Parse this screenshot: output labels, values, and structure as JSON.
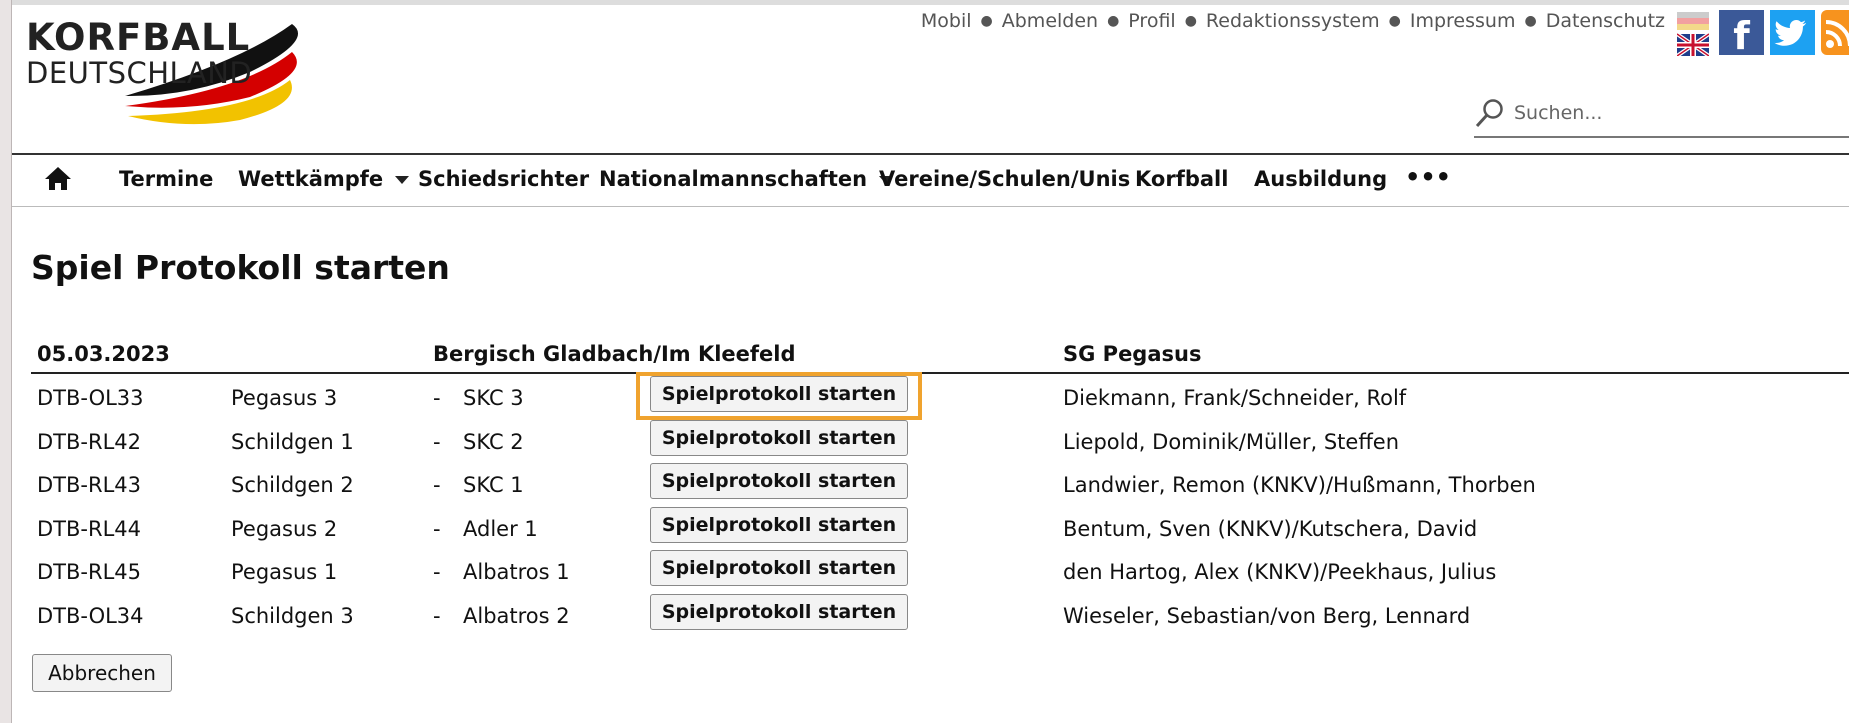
{
  "logo": {
    "line1": "KORFBALL",
    "line2": "DEUTSCHLAND"
  },
  "toplinks": [
    "Mobil",
    "Abmelden",
    "Profil",
    "Redaktionssystem",
    "Impressum",
    "Datenschutz"
  ],
  "search": {
    "placeholder": "Suchen..."
  },
  "nav": {
    "items": [
      "Termine",
      "Wettkämpfe",
      "Schiedsrichter",
      "Nationalmannschaften",
      "Vereine/Schulen/Unis",
      "Korfball",
      "Ausbildung"
    ],
    "more": "•••"
  },
  "page": {
    "title": "Spiel Protokoll starten"
  },
  "table": {
    "date": "05.03.2023",
    "venue": "Bergisch Gladbach/Im Kleefeld",
    "organizer": "SG Pegasus",
    "separator": "-",
    "button_label": "Spielprotokoll starten",
    "rows": [
      {
        "code": "DTB-OL33",
        "home": "Pegasus 3",
        "away": "SKC 3",
        "referees": "Diekmann, Frank/Schneider, Rolf"
      },
      {
        "code": "DTB-RL42",
        "home": "Schildgen 1",
        "away": "SKC 2",
        "referees": "Liepold, Dominik/Müller, Steffen"
      },
      {
        "code": "DTB-RL43",
        "home": "Schildgen 2",
        "away": "SKC 1",
        "referees": "Landwier, Remon (KNKV)/Hußmann, Thorben"
      },
      {
        "code": "DTB-RL44",
        "home": "Pegasus 2",
        "away": "Adler 1",
        "referees": "Bentum, Sven (KNKV)/Kutschera, David"
      },
      {
        "code": "DTB-RL45",
        "home": "Pegasus 1",
        "away": "Albatros 1",
        "referees": "den Hartog, Alex (KNKV)/Peekhaus, Julius"
      },
      {
        "code": "DTB-OL34",
        "home": "Schildgen 3",
        "away": "Albatros 2",
        "referees": "Wieseler, Sebastian/von Berg, Lennard"
      }
    ]
  },
  "cancel_label": "Abbrechen",
  "colors": {
    "highlight": "#f0a32e",
    "facebook": "#3b5998",
    "twitter": "#1da1f2",
    "rss": "#f7931e"
  }
}
